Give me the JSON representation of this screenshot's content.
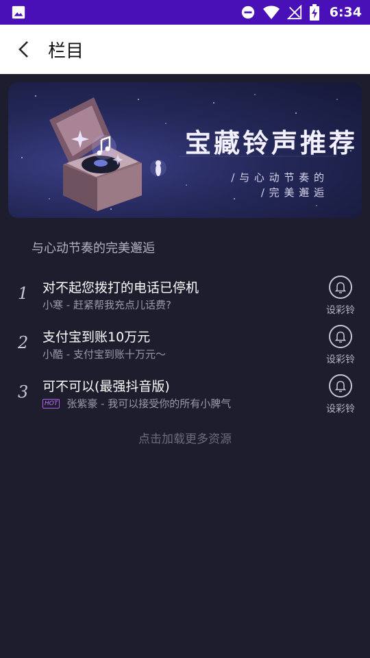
{
  "status_bar": {
    "time": "6:34"
  },
  "header": {
    "title": "栏目"
  },
  "banner": {
    "title": "宝藏铃声推荐",
    "subtitle_line1": "/ 与 心 动 节 奏 的",
    "subtitle_line2": "/ 完 美 邂 逅"
  },
  "section": {
    "title": "与心动节奏的完美邂逅"
  },
  "songs": [
    {
      "index": "1",
      "title": "对不起您拨打的电话已停机",
      "meta": "小寒 - 赶紧帮我充点儿话费?",
      "hot": false,
      "action_label": "设彩铃"
    },
    {
      "index": "2",
      "title": "支付宝到账10万元",
      "meta": "小酷 - 支付宝到账十万元～",
      "hot": false,
      "action_label": "设彩铃"
    },
    {
      "index": "3",
      "title": "可不可以(最强抖音版)",
      "meta": "张紫豪 - 我可以接受你的所有小脾气",
      "hot": true,
      "hot_label": "HOT",
      "action_label": "设彩铃"
    }
  ],
  "footer": {
    "load_more": "点击加载更多资源"
  },
  "icons": {
    "back": "back-arrow-icon",
    "bell": "bell-icon",
    "gallery": "image-icon",
    "dnd": "do-not-disturb-icon",
    "wifi": "wifi-icon",
    "signal": "no-signal-icon",
    "battery": "battery-charging-icon"
  }
}
